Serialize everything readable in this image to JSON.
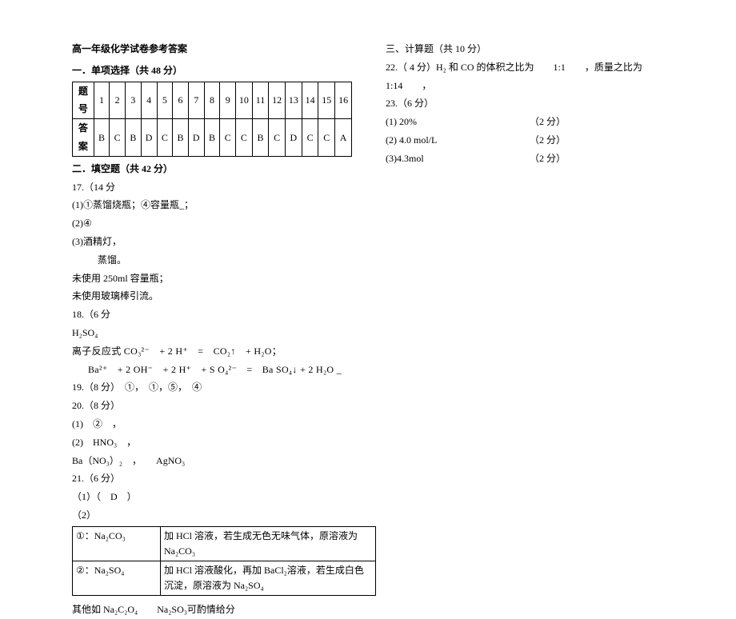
{
  "left": {
    "title": "高一年级化学试卷参考答案",
    "section1": "一．单项选择（共 48 分）",
    "tableHeadLabel": "题号",
    "tableAnsLabel": "答案",
    "nums": [
      "1",
      "2",
      "3",
      "4",
      "5",
      "6",
      "7",
      "8",
      "9",
      "10",
      "11",
      "12",
      "13",
      "14",
      "15",
      "16"
    ],
    "ans": [
      "B",
      "C",
      "B",
      "D",
      "C",
      "B",
      "D",
      "B",
      "C",
      "C",
      "B",
      "C",
      "D",
      "C",
      "C",
      "A"
    ],
    "section2": "二．填空题（共 42 分）",
    "q17head": "17.（14 分",
    "q17_1": "(1)①蒸馏烧瓶；④容量瓶_；",
    "q17_2": "(2)④",
    "q17_3": "(3)酒精灯，",
    "q17_3b": "蒸馏。",
    "q17_4": "未使用 250ml 容量瓶；",
    "q17_5": "未使用玻璃棒引流。",
    "q18head": "18.（6 分",
    "q18_a": "H₂SO₄",
    "q18_b": "离子反应式 CO₃²⁻　+ 2 H⁺　=　CO₂↑　+ H₂O；",
    "q18_c": "Ba²⁺　+ 2 OH⁻　+ 2 H⁺　+ S O₄²⁻　=　Ba SO₄↓ + 2 H₂O _",
    "q19": "19.（8 分）　①，　①，⑤，　④",
    "q20head": "20.（8 分）",
    "q20_1": "(1)　②　，",
    "q20_2": "(2)　HNO₃　，",
    "q20_3": "Ba（NO₃）₂　，　　AgNO₃",
    "q21head": "21.（6 分）",
    "q21_1": "（1）（　D　）",
    "q21_2": "（2）",
    "tbl2_r1c1": "①：Na₂CO₃",
    "tbl2_r1c2": "加 HCl 溶液，若生成无色无味气体，原溶液为 Na₂CO₃",
    "tbl2_r2c1": "②：Na₂SO₄",
    "tbl2_r2c2": "加 HCl 溶液酸化，再加 BaCl₂溶液，若生成白色沉淀，原溶液为 Na₂SO₄",
    "q21_note": "其他如 Na₂C₂O₄　　Na₂SO₃可酌情给分"
  },
  "right": {
    "section3": "三、计算题（共 10 分）",
    "q22": "22.（ 4 分）H₂ 和 CO 的体积之比为　　1:1　　，质量之比为　　1:14　　，",
    "q23head": "23.（6 分）",
    "q23_1": "(1) 20%",
    "q23_2": "(2) 4.0 mol/L",
    "q23_3": "(3)4.3mol",
    "pts": "（2 分）"
  }
}
